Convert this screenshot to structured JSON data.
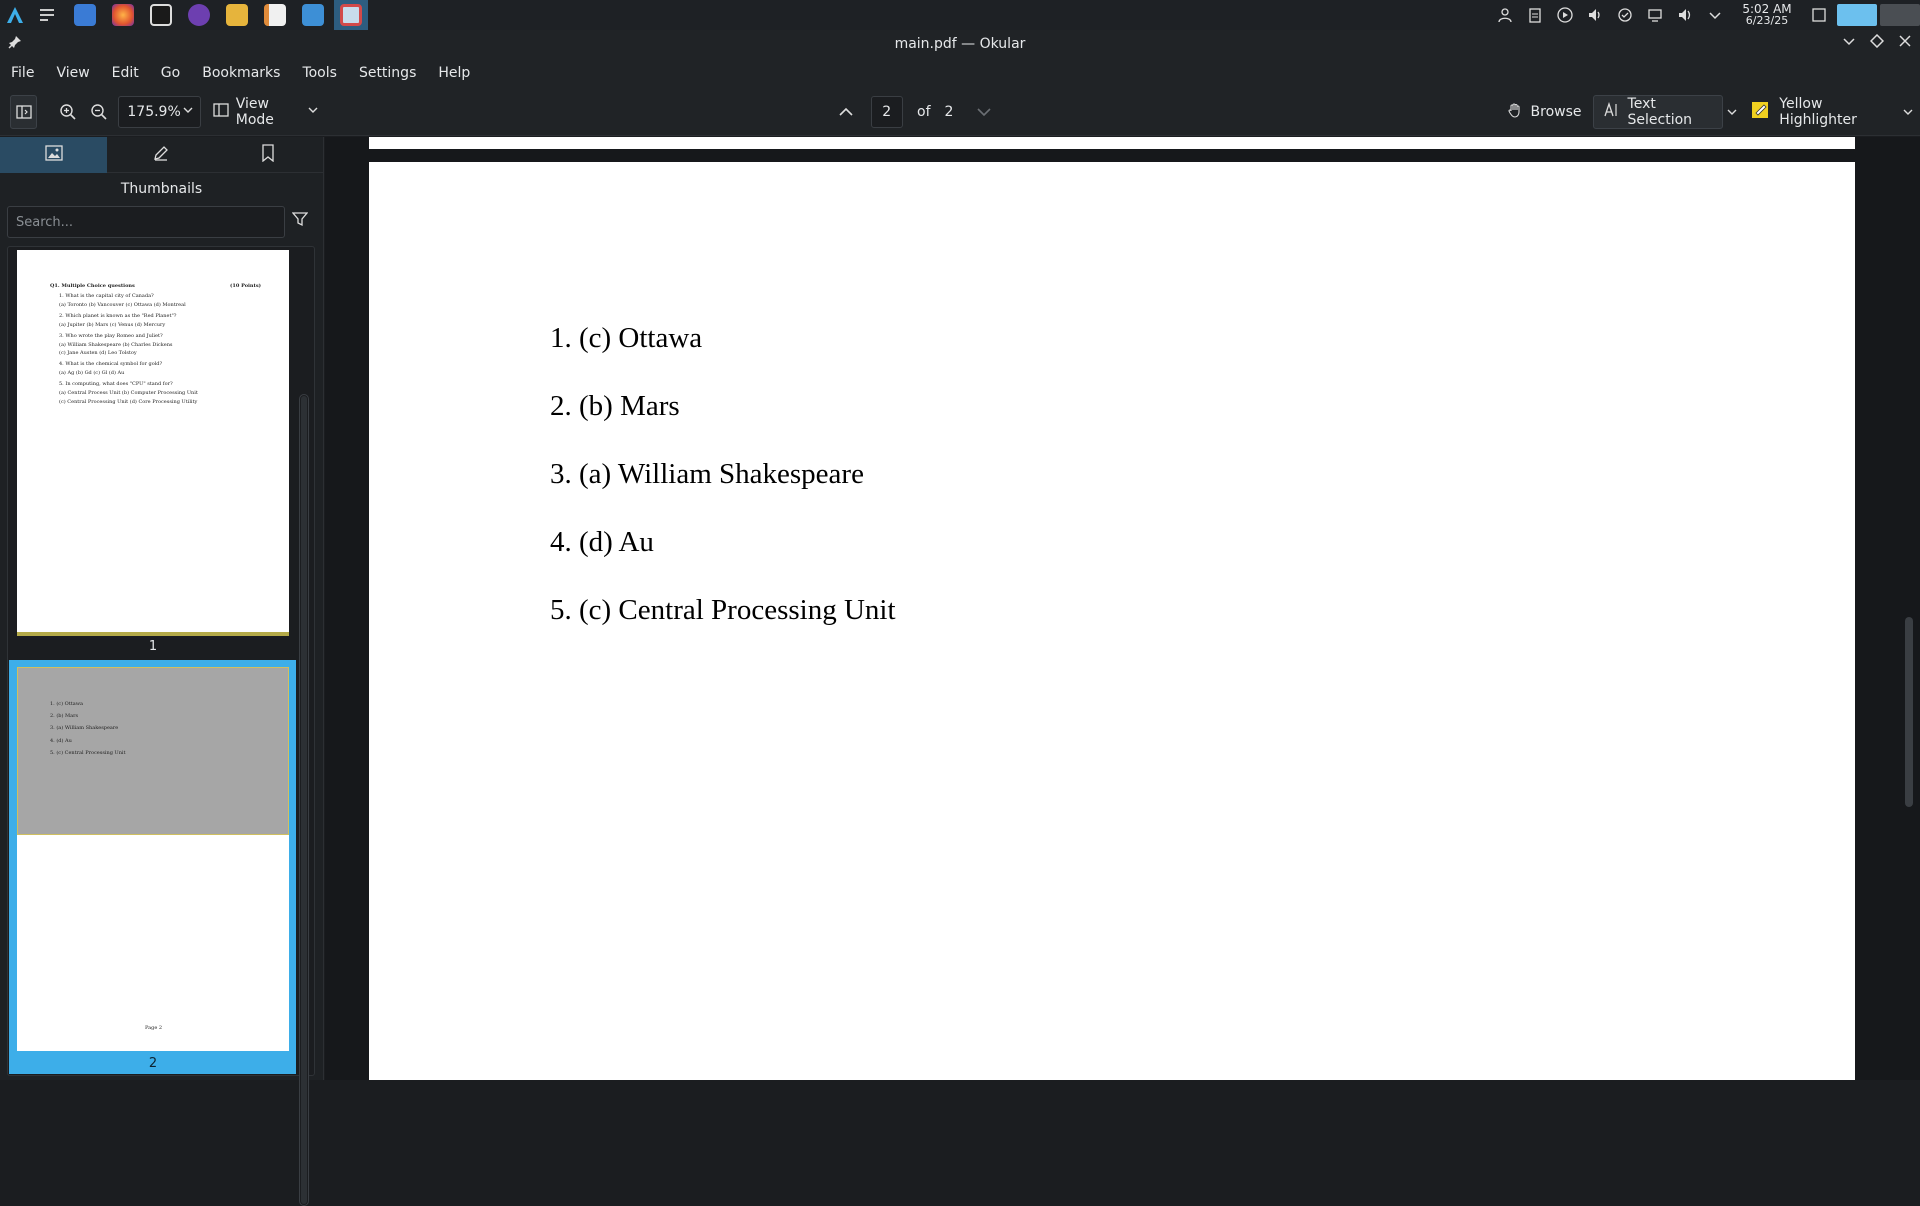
{
  "taskbar": {
    "clock_time": "5:02 AM",
    "clock_date": "6/23/25"
  },
  "window": {
    "title": "main.pdf — Okular"
  },
  "menu": [
    "File",
    "View",
    "Edit",
    "Go",
    "Bookmarks",
    "Tools",
    "Settings",
    "Help"
  ],
  "toolbar": {
    "zoom_value": "175.9%",
    "view_mode_label": "View Mode",
    "current_page": "2",
    "of_label": "of",
    "total_pages": "2",
    "browse_label": "Browse",
    "text_selection_label": "Text Selection",
    "highlighter_label": "Yellow Highlighter"
  },
  "sidebar": {
    "title": "Thumbnails",
    "search_placeholder": "Search...",
    "thumb1_label": "1",
    "thumb2_label": "2"
  },
  "thumb1": {
    "heading": "Q1.  Multiple Choice questions",
    "points": "(10 Points)",
    "lines": [
      "1.  What is the capital city of Canada?",
      "(a) Toronto            (b) Vancouver           (c) Ottawa              (d) Montreal",
      "2.  Which planet is known as the \"Red Planet\"?",
      "(a) Jupiter             (b) Mars                 (c) Venus               (d) Mercury",
      "3.  Who wrote the play Romeo and Juliet?",
      "(a) William Shakespeare                        (b) Charles Dickens",
      "(c) Jane Austen                                  (d) Leo Tolstoy",
      "4.  What is the chemical symbol for gold?",
      "(a) Ag                  (b) Gd                   (c) Gl                   (d) Au",
      "5.  In computing, what does \"CPU\" stand for?",
      "(a) Central Process Unit                      (b) Computer Processing Unit",
      "(c) Central Processing Unit                   (d) Core Processing Utility"
    ]
  },
  "thumb2": {
    "lines": [
      "1. (c) Ottawa",
      "2. (b) Mars",
      "3. (a) William Shakespeare",
      "4. (d) Au",
      "5. (c) Central Processing Unit"
    ],
    "footer": "Page 2"
  },
  "document": {
    "answers": [
      "1. (c) Ottawa",
      "2. (b) Mars",
      "3. (a) William Shakespeare",
      "4. (d) Au",
      "5. (c) Central Processing Unit"
    ]
  }
}
